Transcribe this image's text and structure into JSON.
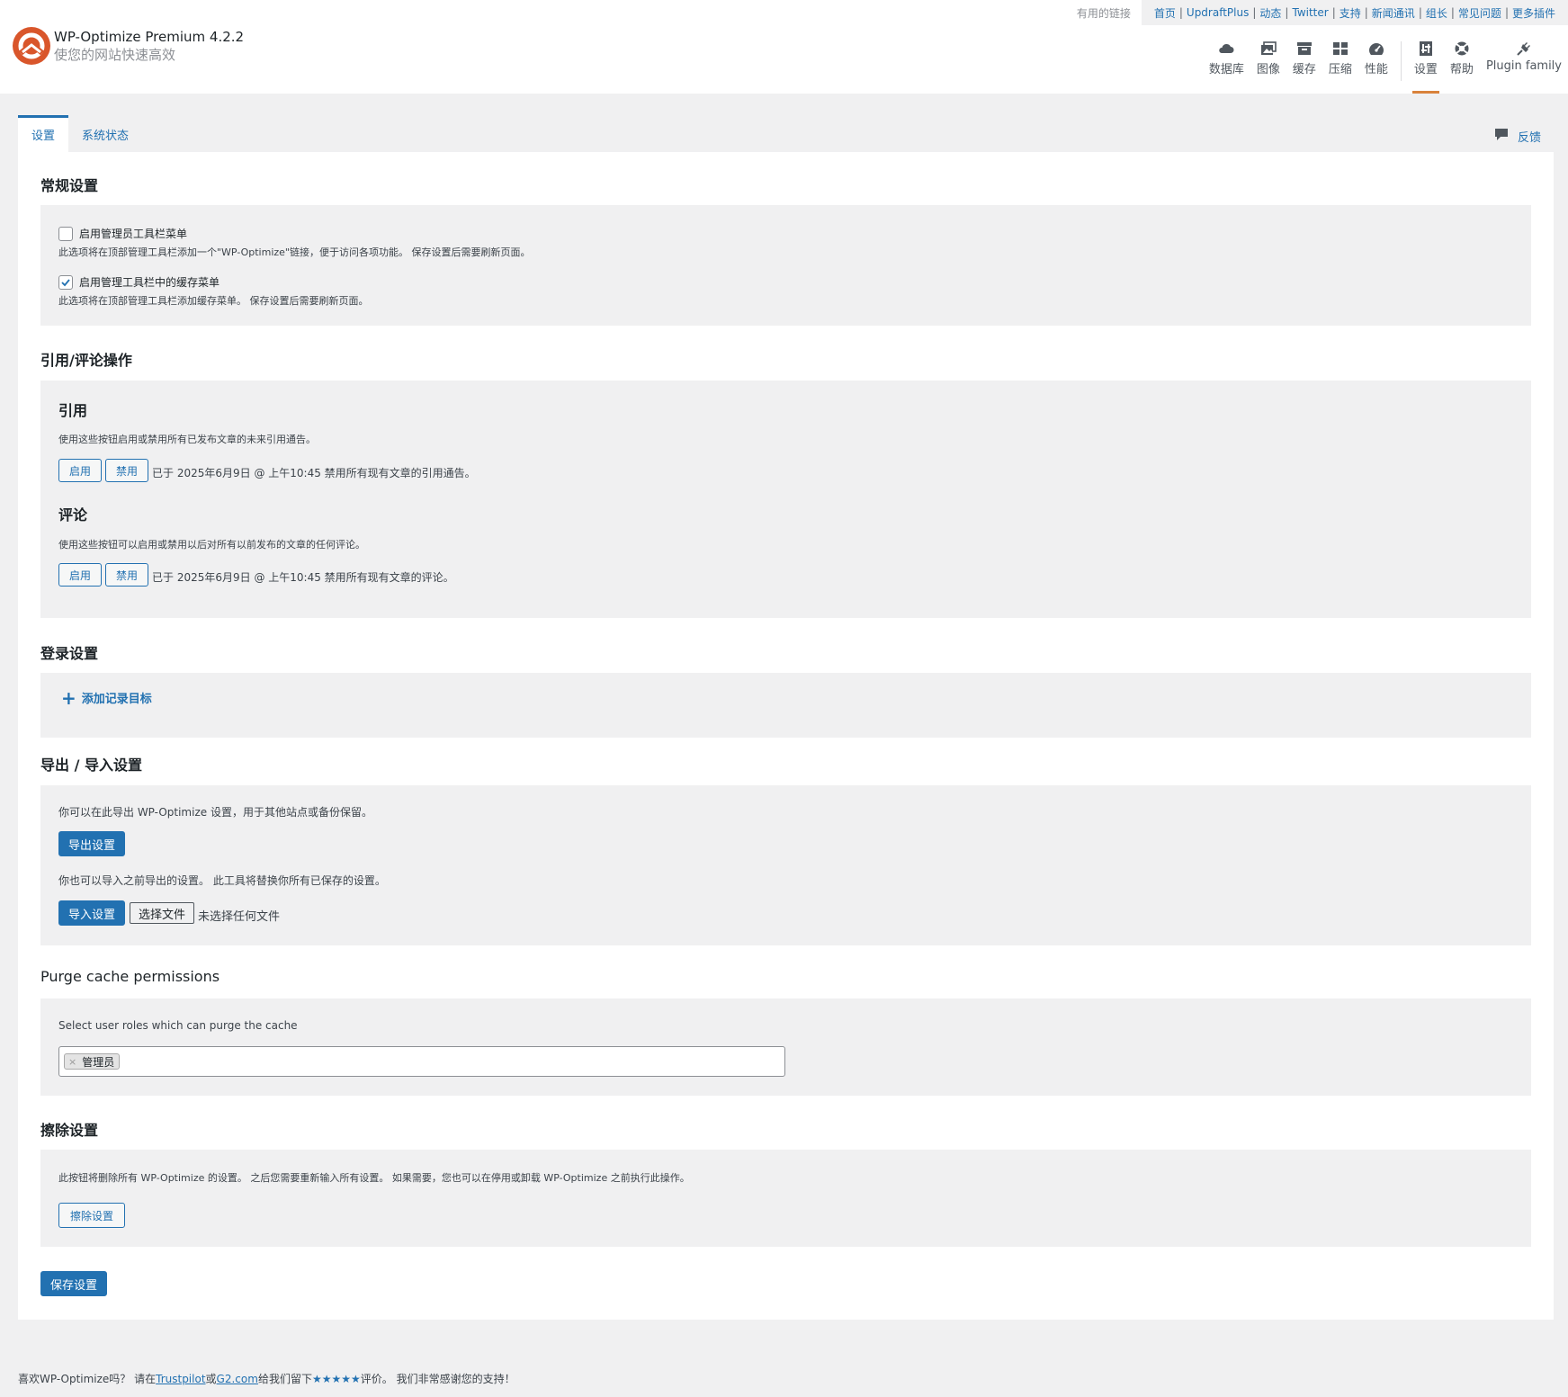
{
  "header": {
    "title": "WP-Optimize Premium 4.2.2",
    "subtitle": "使您的网站快速高效",
    "useful_links_label": "有用的链接",
    "useful_links": [
      "首页",
      "UpdraftPlus",
      "动态",
      "Twitter",
      "支持",
      "新闻通讯",
      "组长",
      "常见问题",
      "更多插件"
    ],
    "nav": [
      {
        "label": "数据库",
        "icon": "cloud-icon"
      },
      {
        "label": "图像",
        "icon": "images-icon"
      },
      {
        "label": "缓存",
        "icon": "archive-icon"
      },
      {
        "label": "压缩",
        "icon": "grid-icon"
      },
      {
        "label": "性能",
        "icon": "dashboard-icon"
      },
      {
        "label": "设置",
        "icon": "settings-icon",
        "active": true
      },
      {
        "label": "帮助",
        "icon": "lifebuoy-icon"
      },
      {
        "label": "Plugin family",
        "icon": "plugin-icon"
      }
    ]
  },
  "tabs": [
    {
      "label": "设置",
      "active": true
    },
    {
      "label": "系统状态",
      "active": false
    }
  ],
  "feedback_label": "反馈",
  "general": {
    "heading": "常规设置",
    "admin_bar_label": "启用管理员工具栏菜单",
    "admin_bar_desc": "此选项将在顶部管理工具栏添加一个\"WP-Optimize\"链接，便于访问各项功能。 保存设置后需要刷新页面。",
    "admin_bar_checked": false,
    "cache_menu_label": "启用管理工具栏中的缓存菜单",
    "cache_menu_desc": "此选项将在顶部管理工具栏添加缓存菜单。 保存设置后需要刷新页面。",
    "cache_menu_checked": true
  },
  "trackbacks_comments": {
    "heading": "引用/评论操作",
    "trackbacks_title": "引用",
    "trackbacks_desc": "使用这些按钮启用或禁用所有已发布文章的未来引用通告。",
    "enable_label": "启用",
    "disable_label": "禁用",
    "trackbacks_status": "已于 2025年6月9日 @ 上午10:45 禁用所有现有文章的引用通告。",
    "comments_title": "评论",
    "comments_desc": "使用这些按钮可以启用或禁用以后对所有以前发布的文章的任何评论。",
    "comments_status": "已于 2025年6月9日 @ 上午10:45 禁用所有现有文章的评论。"
  },
  "logging": {
    "heading": "登录设置",
    "add_destination": "添加记录目标"
  },
  "export_import": {
    "heading": "导出 / 导入设置",
    "export_desc": "你可以在此导出 WP-Optimize 设置，用于其他站点或备份保留。",
    "export_button": "导出设置",
    "import_desc": "你也可以导入之前导出的设置。 此工具将替换你所有已保存的设置。",
    "import_button": "导入设置",
    "choose_file": "选择文件",
    "no_file": "未选择任何文件"
  },
  "purge": {
    "heading": "Purge cache permissions",
    "desc": "Select user roles which can purge the cache",
    "selected_roles": [
      "管理员"
    ]
  },
  "wipe": {
    "heading": "擦除设置",
    "desc": "此按钮将删除所有 WP-Optimize 的设置。 之后您需要重新输入所有设置。 如果需要，您也可以在停用或卸载 WP-Optimize 之前执行此操作。",
    "button": "擦除设置"
  },
  "save_button": "保存设置",
  "footer": {
    "prefix": "喜欢WP-Optimize吗？ 请在",
    "link1": "Trustpilot",
    "or": "或",
    "link2": "G2.com",
    "mid": "给我们留下",
    "stars": "★★★★★",
    "suffix": "评价。 我们非常感谢您的支持！"
  },
  "colors": {
    "accent": "#2271b1",
    "active_nav_underline": "#d9823b",
    "logo": "#d9562b"
  }
}
